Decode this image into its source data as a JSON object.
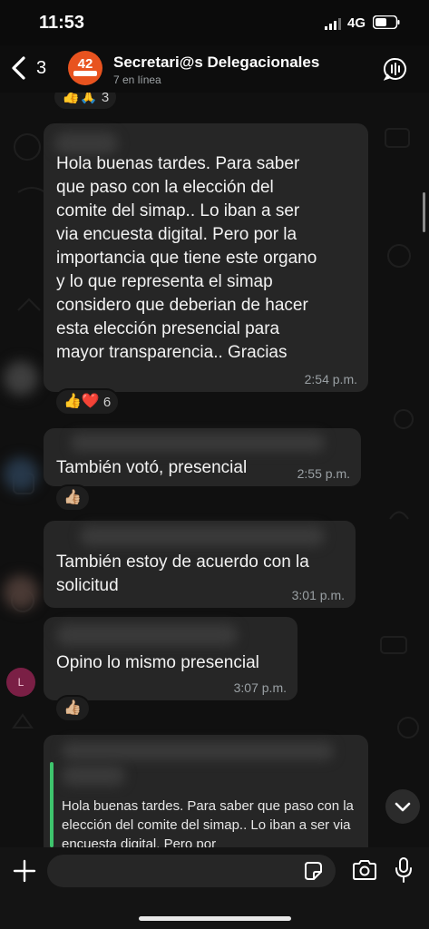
{
  "status_bar": {
    "time": "11:53",
    "network": "4G"
  },
  "header": {
    "back_count": "3",
    "avatar_text": "42",
    "title": "Secretari@s Delegacionales",
    "subtitle": "7 en línea",
    "icons": {
      "back": "chevron-left-icon",
      "call": "group-call-icon"
    }
  },
  "messages": [
    {
      "text": "Hola buenas tardes. Para saber\nque paso con la elección del\ncomite del simap..  Lo iban a ser\nvia encuesta digital.  Pero por la\nimportancia que tiene este organo\ny lo que representa el simap\nconsidero que deberian de hacer\nesta elección presencial para\nmayor transparencia.. Gracias",
      "time": "2:54 p.m.",
      "reactions": {
        "emojis": "👍❤️",
        "count": "6"
      }
    },
    {
      "text": "También votó, presencial",
      "time": "2:55 p.m.",
      "reactions": {
        "emojis": "👍🏼"
      }
    },
    {
      "text": "También estoy de acuerdo con la\nsolicitud",
      "time": "3:01 p.m."
    },
    {
      "text": "Opino lo mismo presencial",
      "time": "3:07 p.m.",
      "sender_initial": "L",
      "reactions": {
        "emojis": "👍🏼"
      }
    }
  ],
  "top_reaction": {
    "emojis": "👍🙏",
    "count": "3"
  },
  "quoted_message": {
    "text": "Hola buenas tardes. Para saber que paso con la elección del comite del simap..  Lo iban a ser via encuesta digital.  Pero por"
  },
  "input_bar": {
    "icons": [
      "plus-icon",
      "sticker-icon",
      "camera-icon",
      "microphone-icon"
    ]
  },
  "colors": {
    "accent": "#3ec46d",
    "bubble": "#262626",
    "background": "#101010",
    "avatar": "#e8531f"
  }
}
